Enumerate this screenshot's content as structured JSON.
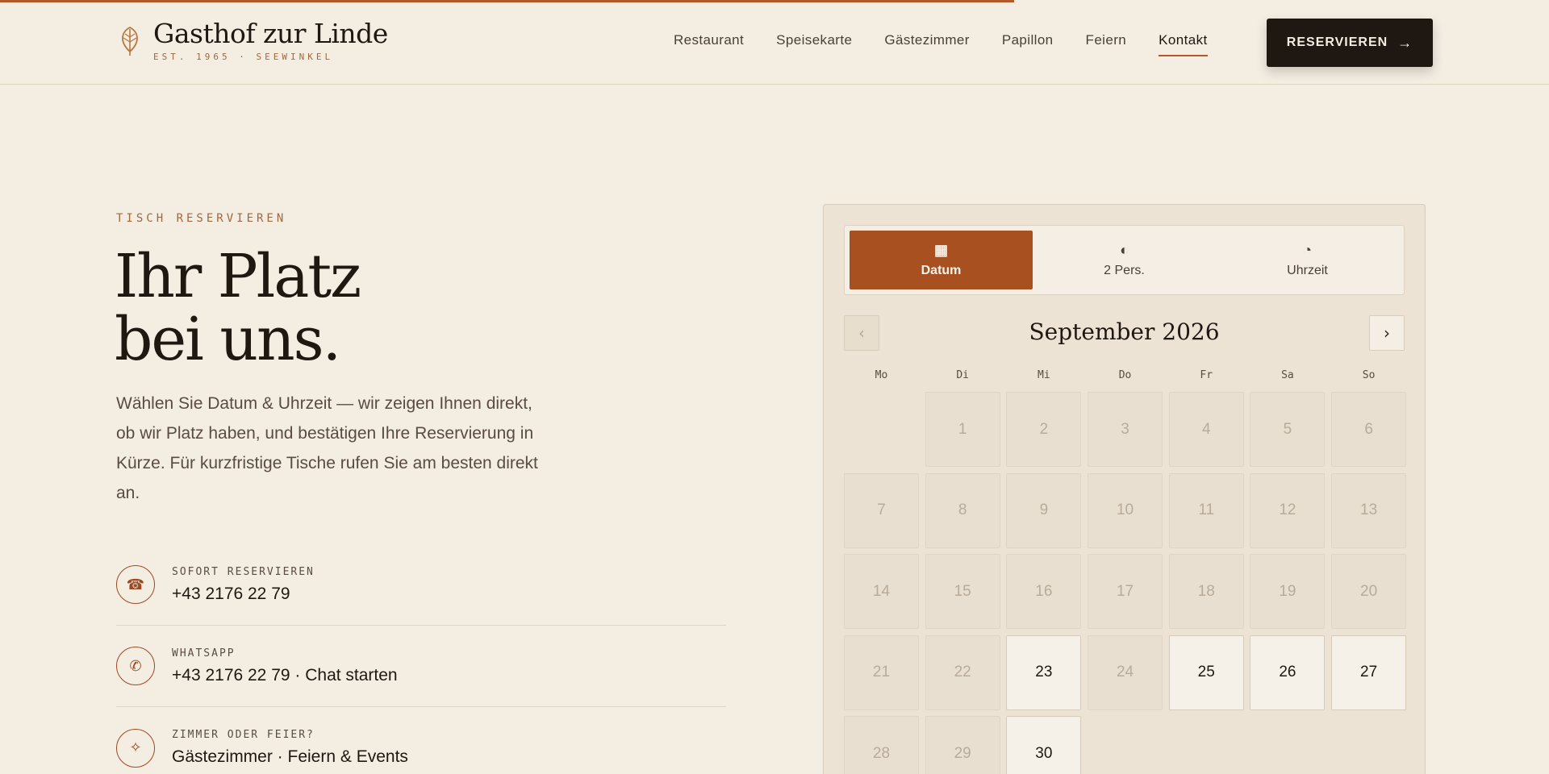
{
  "brand": {
    "name": "Gasthof zur Linde",
    "sub": "EST. 1965 · SEEWINKEL",
    "logo_icon": "leaf-icon"
  },
  "nav": {
    "items": [
      "Restaurant",
      "Speisekarte",
      "Gästezimmer",
      "Papillon",
      "Feiern",
      "Kontakt"
    ],
    "active": "Kontakt",
    "cta_label": "RESERVIEREN",
    "cta_arrow": "→"
  },
  "hero": {
    "eyebrow": "TISCH RESERVIEREN",
    "title_line1": "Ihr Platz",
    "title_line2": "bei uns.",
    "lead": "Wählen Sie Datum & Uhrzeit — wir zeigen Ihnen direkt, ob wir Platz haben, und bestätigen Ihre Reservierung in Kürze. Für kurzfristige Tische rufen Sie am besten direkt an."
  },
  "contacts": [
    {
      "label": "SOFORT RESERVIEREN",
      "value": "+43 2176 22 79",
      "icon": "phone-icon",
      "glyph": "☎"
    },
    {
      "label": "WHATSAPP",
      "value": "+43 2176 22 79 · Chat starten",
      "icon": "whatsapp-icon",
      "glyph": "✆"
    },
    {
      "label": "ZIMMER ODER FEIER?",
      "value": "Gästezimmer · Feiern & Events",
      "icon": "sparkle-icon",
      "glyph": "✧"
    }
  ],
  "booking": {
    "tabs": [
      {
        "label": "Datum",
        "icon": "calendar-icon",
        "glyph": "▦",
        "active": true
      },
      {
        "label": "2 Pers.",
        "icon": "guests-icon",
        "glyph": "◐",
        "active": false
      },
      {
        "label": "Uhrzeit",
        "icon": "clock-icon",
        "glyph": "◔",
        "active": false
      }
    ],
    "month": "September 2026",
    "prev": "‹",
    "next": "›",
    "weekdays": [
      "Mo",
      "Di",
      "Mi",
      "Do",
      "Fr",
      "Sa",
      "So"
    ],
    "leading_blanks": 1,
    "days": [
      "1",
      "2",
      "3",
      "4",
      "5",
      "6",
      "7",
      "8",
      "9",
      "10",
      "11",
      "12",
      "13",
      "14",
      "15",
      "16",
      "17",
      "18",
      "19",
      "20",
      "21",
      "22",
      "23",
      "24",
      "25",
      "26",
      "27",
      "28",
      "29",
      "30"
    ],
    "available": [
      "23",
      "25",
      "26",
      "27",
      "30"
    ]
  },
  "colors": {
    "accent": "#a8501f",
    "background": "#f3ede2",
    "dark": "#1f1711"
  }
}
